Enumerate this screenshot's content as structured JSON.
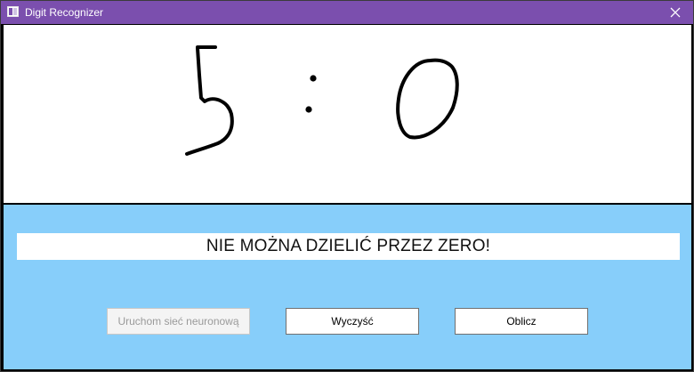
{
  "window": {
    "title": "Digit Recognizer",
    "accent_color": "#7b4fae",
    "icons": {
      "app": "app-icon",
      "close": "close-icon"
    }
  },
  "canvas": {
    "drawn_content": "5 : 0"
  },
  "result": {
    "text": "NIE MOŻNA DZIELIĆ PRZEZ ZERO!"
  },
  "buttons": {
    "start": {
      "label": "Uruchom sieć neuronową",
      "enabled": false
    },
    "clear": {
      "label": "Wyczyść",
      "enabled": true
    },
    "calculate": {
      "label": "Oblicz",
      "enabled": true
    }
  },
  "colors": {
    "lower_panel": "#87cefa",
    "canvas": "#ffffff"
  }
}
